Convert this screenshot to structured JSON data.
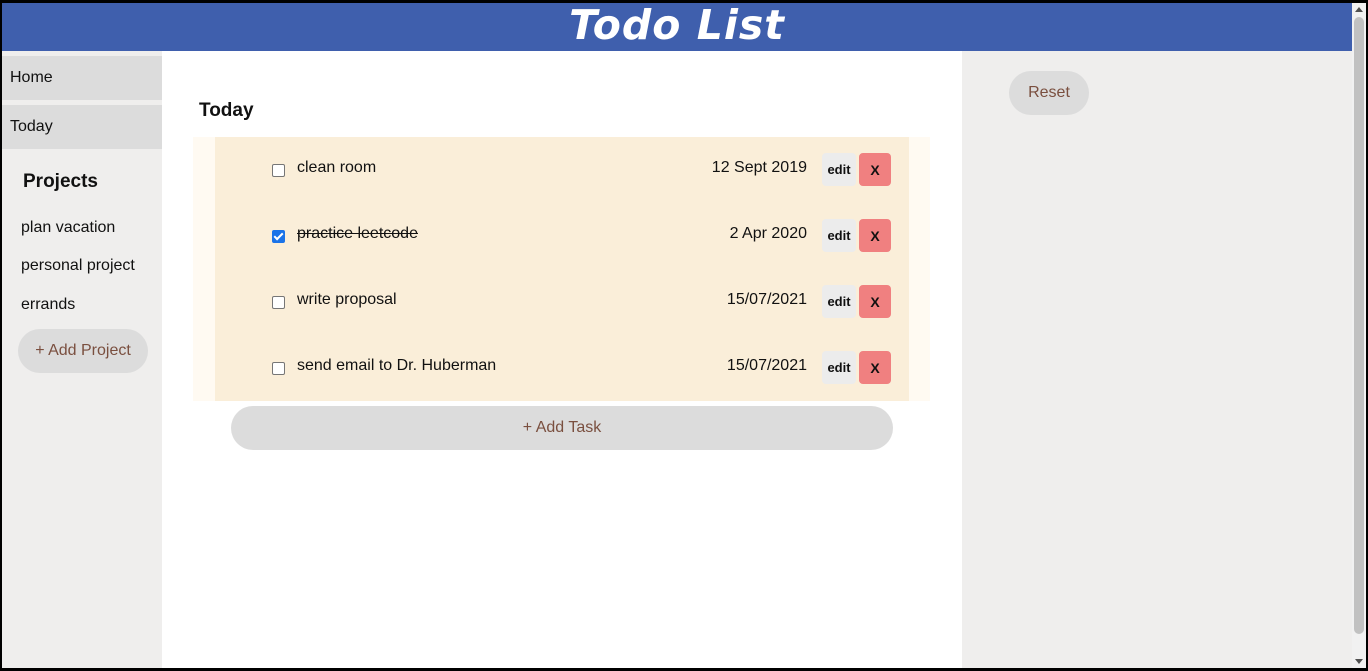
{
  "header": {
    "title": "Todo List"
  },
  "sidebar": {
    "nav": [
      {
        "label": "Home"
      },
      {
        "label": "Today"
      }
    ],
    "projects_heading": "Projects",
    "projects": [
      {
        "label": "plan vacation"
      },
      {
        "label": "personal project"
      },
      {
        "label": "errands"
      }
    ],
    "add_project_label": "+ Add Project"
  },
  "main": {
    "section_title": "Today",
    "tasks": [
      {
        "name": "clean room",
        "date": "12 Sept 2019",
        "done": false,
        "edit_label": "edit",
        "delete_label": "X"
      },
      {
        "name": "practice leetcode",
        "date": "2 Apr 2020",
        "done": true,
        "edit_label": "edit",
        "delete_label": "X"
      },
      {
        "name": "write proposal",
        "date": "15/07/2021",
        "done": false,
        "edit_label": "edit",
        "delete_label": "X"
      },
      {
        "name": "send email to Dr. Huberman",
        "date": "15/07/2021",
        "done": false,
        "edit_label": "edit",
        "delete_label": "X"
      }
    ],
    "add_task_label": "+ Add Task"
  },
  "right_panel": {
    "reset_label": "Reset"
  },
  "colors": {
    "header_bg": "#3f5fad",
    "sidebar_bg": "#efeeed",
    "task_bg": "#faeed9",
    "delete_bg": "#f08080",
    "button_text": "#7a4f3f",
    "checkbox_checked": "#1a73e8"
  },
  "icons": {
    "checkbox_checked": "checkbox-checked-icon",
    "checkbox_unchecked": "checkbox-unchecked-icon"
  }
}
